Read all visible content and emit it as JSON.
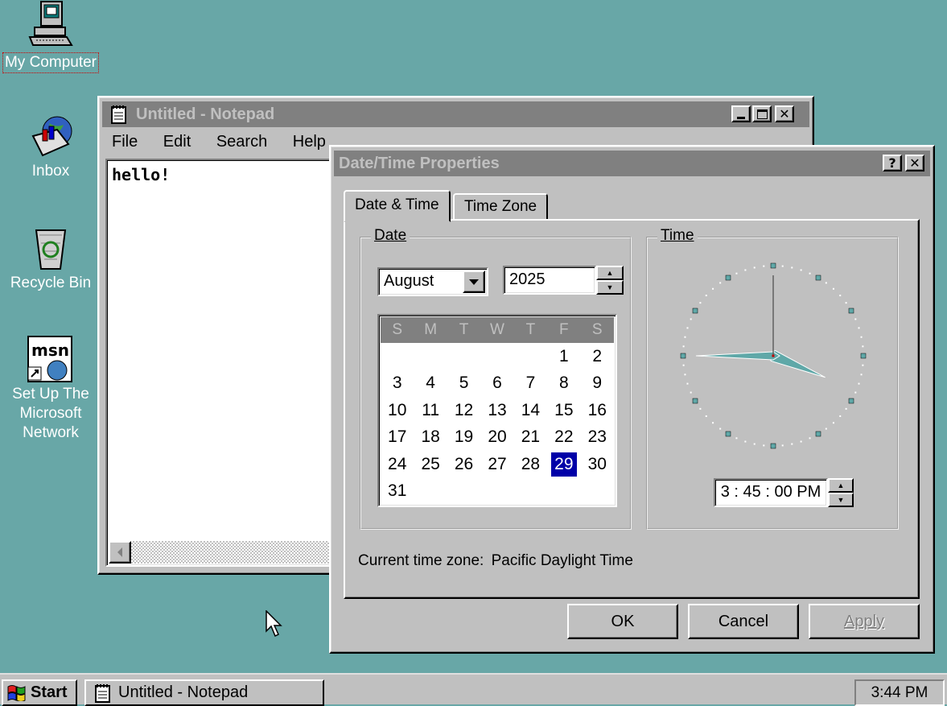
{
  "desktop": {
    "icons": [
      {
        "label": "My Computer"
      },
      {
        "label": "Inbox"
      },
      {
        "label": "Recycle Bin"
      },
      {
        "label": "Set Up The Microsoft Network"
      }
    ]
  },
  "notepad": {
    "title": "Untitled - Notepad",
    "menu": {
      "file": "File",
      "edit": "Edit",
      "search": "Search",
      "help": "Help"
    },
    "content": "hello!"
  },
  "dialog": {
    "title": "Date/Time Properties",
    "tabs": {
      "date_time": "Date & Time",
      "time_zone": "Time Zone"
    },
    "date_group": "Date",
    "time_group": "Time",
    "month": "August",
    "year": "2025",
    "weekdays": [
      "S",
      "M",
      "T",
      "W",
      "T",
      "F",
      "S"
    ],
    "days": [
      "",
      "",
      "",
      "",
      "",
      "1",
      "2",
      "3",
      "4",
      "5",
      "6",
      "7",
      "8",
      "9",
      "10",
      "11",
      "12",
      "13",
      "14",
      "15",
      "16",
      "17",
      "18",
      "19",
      "20",
      "21",
      "22",
      "23",
      "24",
      "25",
      "26",
      "27",
      "28",
      "29",
      "30",
      "31"
    ],
    "selected_day": "29",
    "time_value": "3 : 45 : 00 PM",
    "clock": {
      "hour": 3,
      "minute": 45,
      "second": 0
    },
    "timezone_label": "Current time zone:",
    "timezone_value": "Pacific Daylight Time",
    "buttons": {
      "ok": "OK",
      "cancel": "Cancel",
      "apply": "Apply"
    }
  },
  "taskbar": {
    "start": "Start",
    "task": "Untitled - Notepad",
    "clock": "3:44 PM"
  },
  "colors": {
    "desktop": "#68a7a7",
    "selection": "#0000a8",
    "inactive_title": "#808080"
  }
}
